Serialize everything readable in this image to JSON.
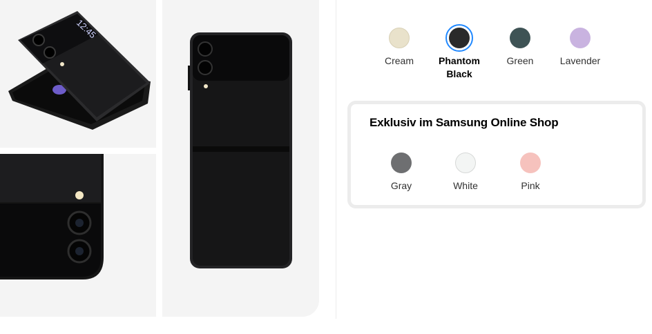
{
  "colors": {
    "standard": [
      {
        "label": "Cream",
        "hex": "#e9e2cb",
        "selected": false
      },
      {
        "label": "Phantom Black",
        "label_line1": "Phantom",
        "label_line2": "Black",
        "hex": "#2a2a2a",
        "selected": true
      },
      {
        "label": "Green",
        "hex": "#3e5355",
        "selected": false
      },
      {
        "label": "Lavender",
        "hex": "#c9b3e0",
        "selected": false
      }
    ],
    "selected_ring": "#2189ff"
  },
  "exclusive": {
    "title": "Exklusiv im Samsung Online Shop",
    "colors": [
      {
        "label": "Gray",
        "hex": "#6e6f71"
      },
      {
        "label": "White",
        "hex": "#f3f5f4"
      },
      {
        "label": "Pink",
        "hex": "#f6c2bd"
      }
    ]
  },
  "gallery": {
    "phone_cover_time": "12:45"
  }
}
